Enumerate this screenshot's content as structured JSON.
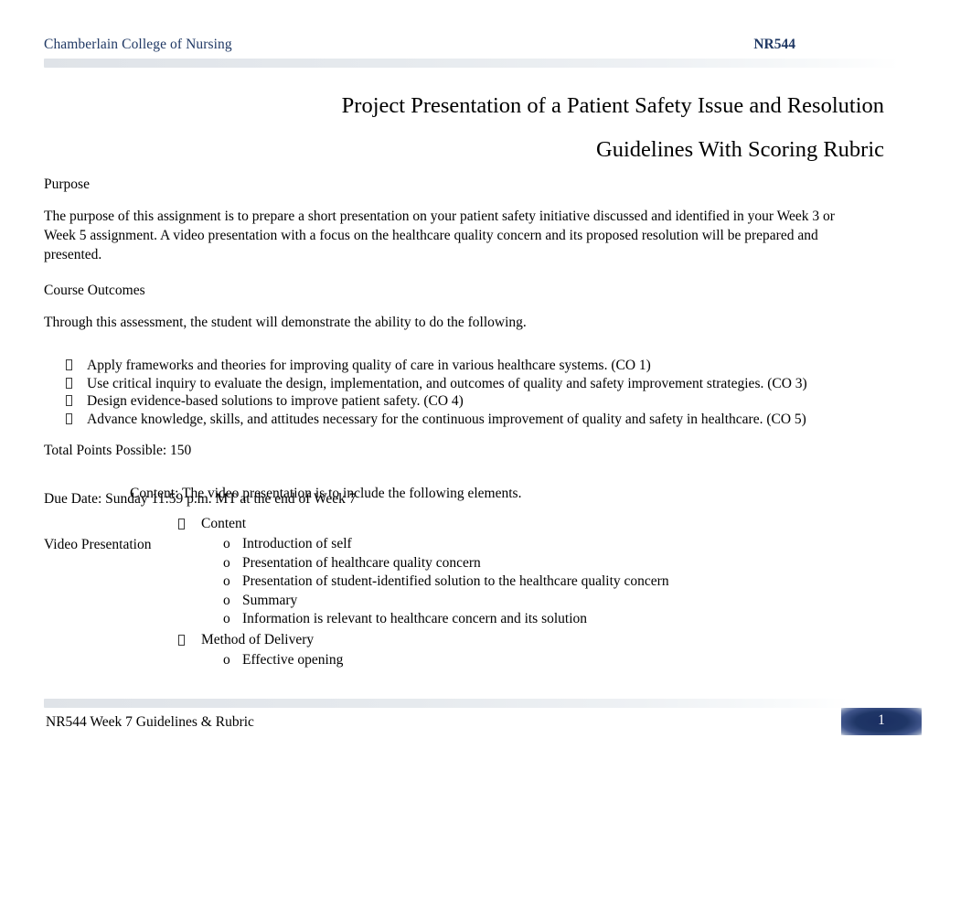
{
  "header": {
    "institution": "Chamberlain College of Nursing",
    "course_code": "NR544"
  },
  "title": {
    "line1": "Project Presentation of a Patient Safety Issue and Resolution",
    "line2": "Guidelines With Scoring Rubric"
  },
  "sections": {
    "purpose_heading": "Purpose",
    "purpose_text": "The purpose of this assignment is to prepare a short presentation on your patient safety initiative discussed and identified in your Week 3 or Week 5 assignment. A video presentation with a focus on the healthcare quality concern and its proposed resolution will be prepared and presented.",
    "course_outcomes_heading": "Course Outcomes",
    "course_outcomes_intro": "Through this assessment, the student will demonstrate the ability to do the following.",
    "outcomes": [
      "Apply frameworks and theories for improving quality of care in various healthcare systems. (CO 1)",
      "Use critical inquiry to evaluate the design, implementation, and outcomes of quality and safety improvement strategies. (CO 3)",
      "Design evidence-based solutions to improve patient safety. (CO 4)",
      "Advance knowledge, skills, and attitudes necessary for the continuous improvement of quality and safety in healthcare. (CO 5)"
    ],
    "total_points": "Total Points Possible: 150",
    "due_date": "Due Date:   Sunday 11:59 p.m. MT at the end of Week 7",
    "video_presentation_heading": "Video Presentation",
    "content_intro": "Content: The video presentation is to include the following elements.",
    "groups": [
      {
        "label": "Content",
        "items": [
          "Introduction of self",
          "Presentation of healthcare quality concern",
          "Presentation of student-identified solution to the healthcare quality concern",
          "Summary",
          "Information is relevant to healthcare concern and its solution"
        ]
      },
      {
        "label": "Method of Delivery",
        "items": [
          "Effective opening"
        ]
      }
    ]
  },
  "footer": {
    "text": "NR544 Week 7 Guidelines & Rubric",
    "page_number": "1"
  },
  "icons": {
    "sub_bullet_marker": "o"
  },
  "colors": {
    "header_navy": "#1f3864",
    "badge_navy": "#1f3666",
    "rule_grey": "#dfe3e8",
    "body_text": "#000000"
  }
}
